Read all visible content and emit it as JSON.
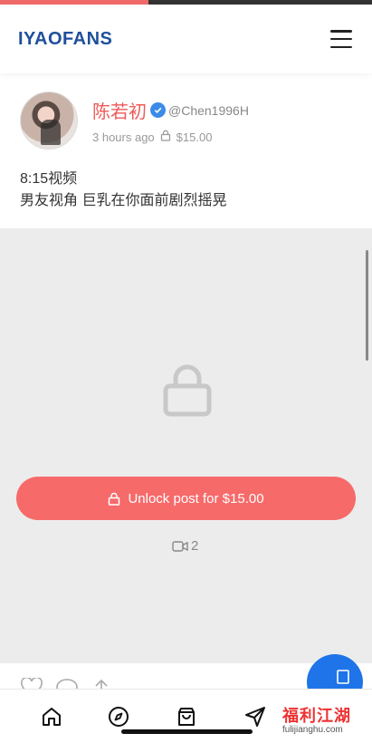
{
  "app": {
    "logo": "IYAOFANS",
    "accent": "#f76a6a",
    "brand": "#1f4f9b"
  },
  "post": {
    "author_name": "陈若初",
    "handle": "@Chen1996H",
    "time": "3 hours ago",
    "price": "$15.00",
    "text_line1": "8:15视频",
    "text_line2": "男友视角 巨乳在你面前剧烈摇晃"
  },
  "media": {
    "unlock_label": "Unlock post for $15.00",
    "video_count": "2"
  },
  "watermark": {
    "title": "福利江湖",
    "sub": "fulijianghu.com"
  }
}
